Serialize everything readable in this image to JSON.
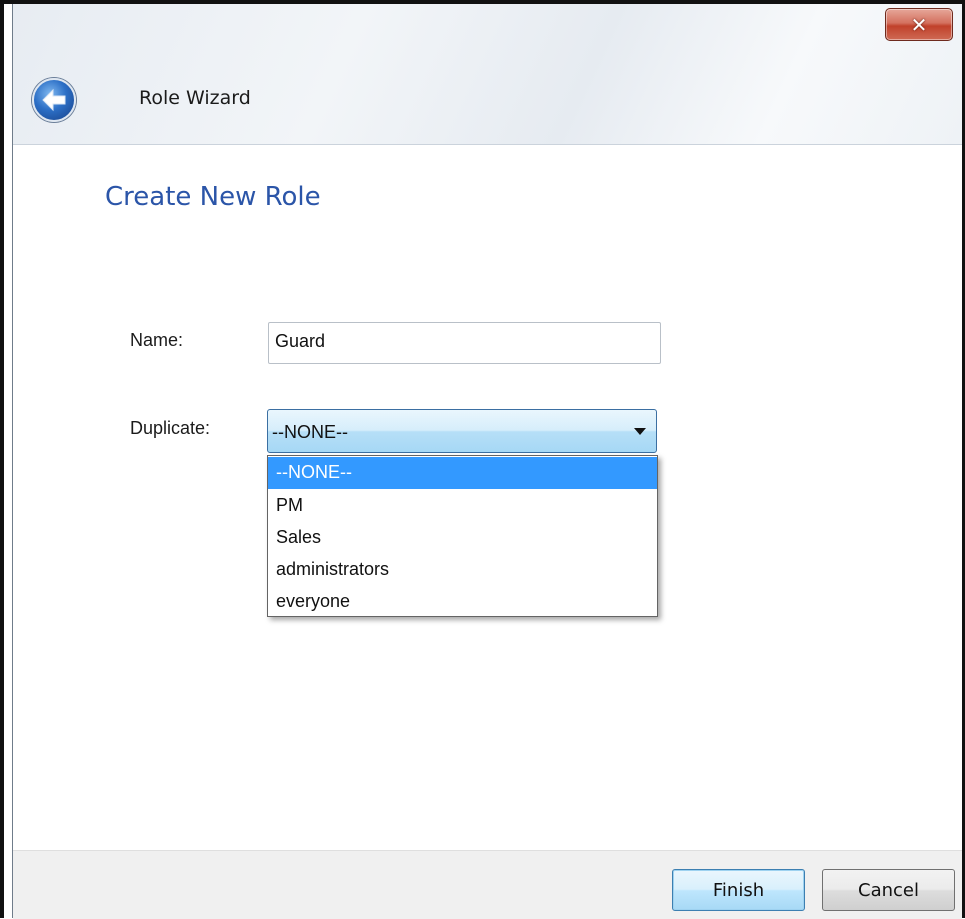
{
  "window": {
    "title": "Role Wizard",
    "close_glyph": "✕"
  },
  "page": {
    "title": "Create New Role"
  },
  "form": {
    "name_label": "Name:",
    "name_value": "Guard",
    "duplicate_label": "Duplicate:",
    "duplicate_selected": "--NONE--",
    "duplicate_options": [
      "--NONE--",
      "PM",
      "Sales",
      "administrators",
      "everyone"
    ]
  },
  "footer": {
    "finish_label": "Finish",
    "cancel_label": "Cancel"
  },
  "colors": {
    "title_blue": "#2b55a8",
    "selection_blue": "#3399ff",
    "close_red": "#c0412b"
  },
  "icons": {
    "back": "back-arrow-icon",
    "close": "close-icon",
    "dropdown": "chevron-down-icon"
  }
}
